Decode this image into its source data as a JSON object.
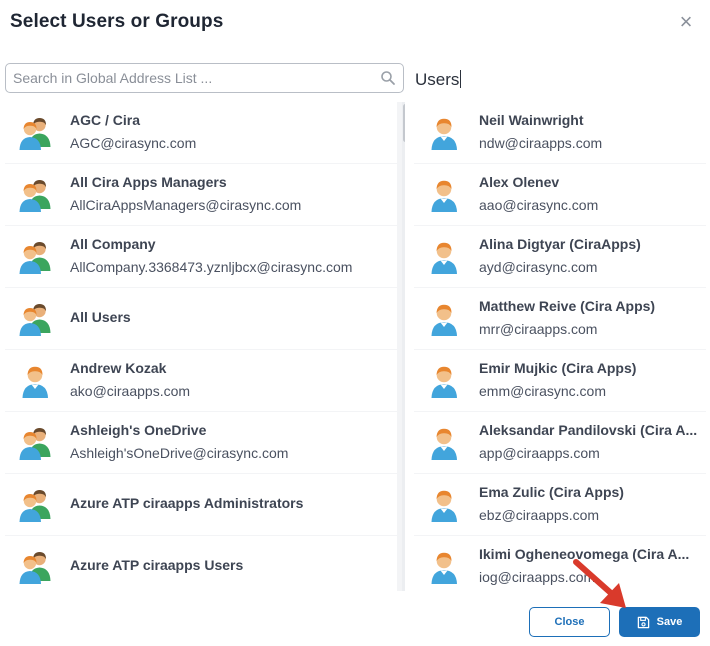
{
  "dialog": {
    "title": "Select Users or Groups",
    "close_icon": "close-icon"
  },
  "search": {
    "placeholder": "Search in Global Address List ...",
    "value": "",
    "icon": "search-icon"
  },
  "right_panel": {
    "title": "Users"
  },
  "left_list": [
    {
      "name": "AGC / Cira",
      "email": "AGC@cirasync.com",
      "type": "group"
    },
    {
      "name": "All Cira Apps Managers",
      "email": "AllCiraAppsManagers@cirasync.com",
      "type": "group"
    },
    {
      "name": "All Company",
      "email": "AllCompany.3368473.yznljbcx@cirasync.com",
      "type": "group"
    },
    {
      "name": "All Users",
      "email": "",
      "type": "group"
    },
    {
      "name": "Andrew Kozak",
      "email": "ako@ciraapps.com",
      "type": "user"
    },
    {
      "name": "Ashleigh's OneDrive",
      "email": "Ashleigh'sOneDrive@cirasync.com",
      "type": "group"
    },
    {
      "name": "Azure ATP ciraapps Administrators",
      "email": "",
      "type": "group"
    },
    {
      "name": "Azure ATP ciraapps Users",
      "email": "",
      "type": "group"
    }
  ],
  "right_list": [
    {
      "name": "Neil Wainwright",
      "email": "ndw@ciraapps.com"
    },
    {
      "name": "Alex Olenev",
      "email": "aao@cirasync.com"
    },
    {
      "name": "Alina Digtyar (CiraApps)",
      "email": "ayd@cirasync.com"
    },
    {
      "name": "Matthew Reive (Cira Apps)",
      "email": "mrr@ciraapps.com"
    },
    {
      "name": "Emir Mujkic (Cira Apps)",
      "email": "emm@cirasync.com"
    },
    {
      "name": "Aleksandar Pandilovski (Cira A...",
      "email": "app@ciraapps.com"
    },
    {
      "name": "Ema Zulic (Cira Apps)",
      "email": "ebz@ciraapps.com"
    },
    {
      "name": "Ikimi Ogheneovomega (Cira A...",
      "email": "iog@ciraapps.com"
    }
  ],
  "footer": {
    "close_label": "Close",
    "save_label": "Save",
    "save_icon": "save-icon"
  },
  "colors": {
    "accent": "#1d6fb8",
    "annotation_arrow": "#d93a2b"
  }
}
